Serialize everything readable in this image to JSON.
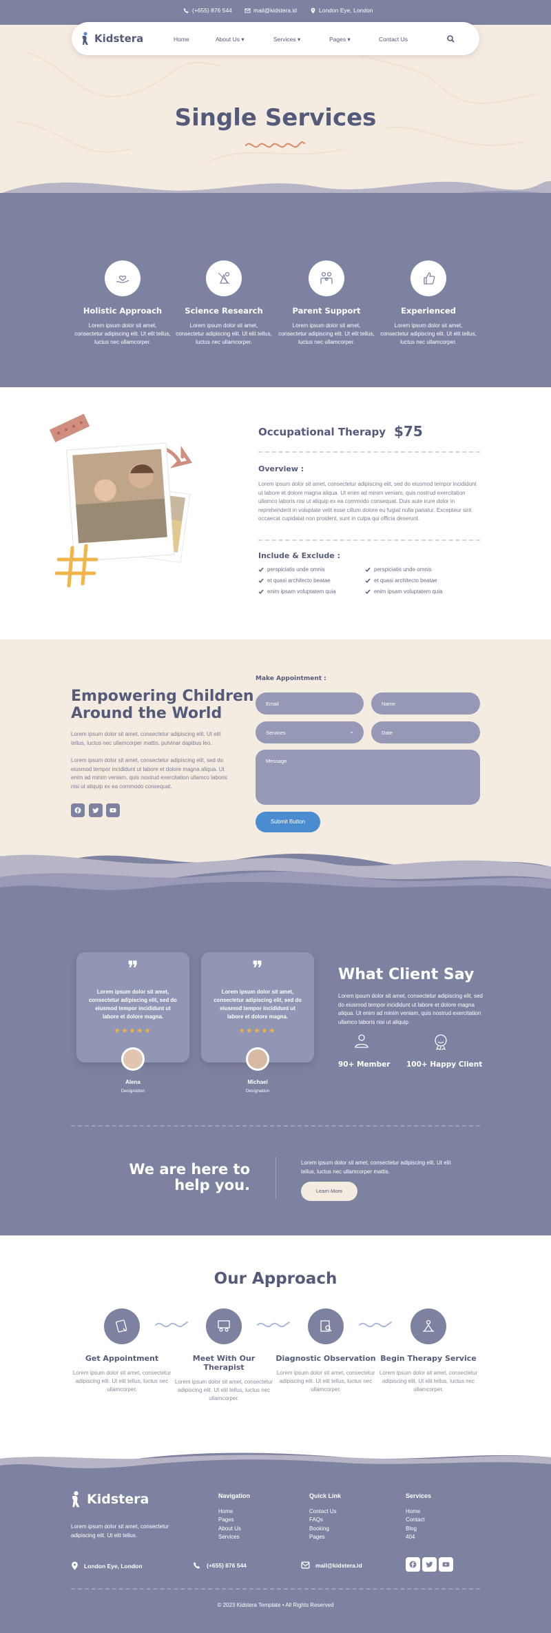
{
  "colors": {
    "slate": "#7d82a0",
    "cream": "#f4ebe1",
    "accent_blue": "#4a8ccf",
    "star": "#f7b733"
  },
  "topbar": {
    "phone": "(+655) 876 544",
    "email": "mail@kidstera.id",
    "location": "London Eye, London"
  },
  "brand": {
    "name": "Kidstera"
  },
  "nav": {
    "home": "Home",
    "about": "About Us",
    "services": "Services",
    "pages": "Pages",
    "contact": "Contact Us"
  },
  "hero": {
    "title": "Single Services"
  },
  "features": [
    {
      "icon": "heart-hand-icon",
      "title": "Holistic Approach",
      "desc": "Lorem ipsum dolor sit amet, consectetur adipiscing elit. Ut elit tellus, luctus nec ullamcorper."
    },
    {
      "icon": "research-icon",
      "title": "Science Research",
      "desc": "Lorem ipsum dolor sit amet, consectetur adipiscing elit. Ut elit tellus, luctus nec ullamcorper."
    },
    {
      "icon": "family-icon",
      "title": "Parent Support",
      "desc": "Lorem ipsum dolor sit amet, consectetur adipiscing elit. Ut elit tellus, luctus nec ullamcorper."
    },
    {
      "icon": "thumbs-up-icon",
      "title": "Experienced",
      "desc": "Lorem ipsum dolor sit amet, consectetur adipiscing elit. Ut elit tellus, luctus nec ullamcorper."
    }
  ],
  "service": {
    "name": "Occupational Therapy",
    "price": "$75",
    "overview_label": "Overview :",
    "overview_text": "Lorem ipsum dolor sit amet, consectetur adipiscing elit, sed do eiusmod tempor incididunt ut labore et dolore magna aliqua. Ut enim ad minim veniam, quis nostrud exercitation ullamco laboris nisi ut aliquip ex ea commodo consequat. Duis aute irure dolor in reprehenderit in voluptate velit esse cillum dolore eu fugiat nulla pariatur. Excepteur sint occaecat cupidatat non proident, sunt in culpa qui officia deserunt.",
    "include_label": "Include & Exclude :",
    "include_left": [
      "perspiciatis unde omnis",
      "et quasi architecto beatae",
      "enim ipsam voluptatem quia"
    ],
    "include_right": [
      "perspiciatis unde omnis",
      "et quasi architecto beatae",
      "enim ipsam voluptatem quia"
    ]
  },
  "appointment": {
    "heading_line1": "Empowering Children",
    "heading_line2": "Around the World",
    "text1": "Lorem ipsum dolor sit amet, consectetur adipiscing elit. Ut elit tellus, luctus nec ullamcorper mattis, pulvinar dapibus leo.",
    "text2": "Lorem ipsum dolor sit amet, consectetur adipiscing elit, sed do eiusmod tempor incididunt ut labore et dolore magna aliqua. Ut enim ad minim veniam, quis nostrud exercitation ullamco laboris nisi ut aliquip ex ea commodo consequat.",
    "form_title": "Make Appointment :",
    "email_ph": "Email",
    "name_ph": "Name",
    "services_ph": "Services",
    "date_ph": "Date",
    "message_ph": "Message",
    "submit": "Submit Button"
  },
  "testimonials": {
    "cards": [
      {
        "quote": "Lorem ipsum dolor sit amet, consectetur adipiscing elit, sed do eiusmod tempor incididunt ut labore et dolore magna.",
        "name": "Alena",
        "role": "Designation"
      },
      {
        "quote": "Lorem ipsum dolor sit amet, consectetur adipiscing elit, sed do eiusmod tempor incididunt ut labore et dolore magna.",
        "name": "Michael",
        "role": "Designation"
      }
    ],
    "heading": "What Client Say",
    "text": "Lorem ipsum dolor sit amet, consectetur adipiscing elit, sed do eiusmod tempor incididunt ut labore et dolore magna aliqua. Ut enim ad minim veniam, quis nostrud exercitation ullamco laboris nisi ut aliquip.",
    "stat1": "90+ Member",
    "stat2": "100+ Happy Client",
    "stars": "★★★★★"
  },
  "cta": {
    "line1": "We are here to",
    "line2": "help you.",
    "text": "Lorem ipsum dolor sit amet, consectetur adipiscing elit. Ut elit tellus, luctus nec ullamcorper mattis.",
    "button": "Learn More"
  },
  "approach": {
    "title": "Our Approach",
    "steps": [
      {
        "title": "Get Appointment",
        "desc": "Lorem ipsum dolor sit amet, consectetur adipiscing elit. Ut elit tellus, luctus nec ullamcorper."
      },
      {
        "title": "Meet With Our Therapist",
        "desc": "Lorem ipsum dolor sit amet, consectetur adipiscing elit. Ut elit tellus, luctus nec ullamcorper."
      },
      {
        "title": "Diagnostic Observation",
        "desc": "Lorem ipsum dolor sit amet, consectetur adipiscing elit. Ut elit tellus, luctus nec ullamcorper."
      },
      {
        "title": "Begin Therapy Service",
        "desc": "Lorem ipsum dolor sit amet, consectetur adipiscing elit. Ut elit tellus, luctus nec ullamcorper."
      }
    ]
  },
  "footer": {
    "about": "Lorem ipsum dolor sit amet, consectetur adipiscing elit. Ut elit tellus.",
    "nav_title": "Navigation",
    "nav_items": [
      "Home",
      "Pages",
      "About Us",
      "Services"
    ],
    "quick_title": "Quick Link",
    "quick_items": [
      "Contact Us",
      "FAQs",
      "Booking",
      "Pages"
    ],
    "services_title": "Services",
    "services_items": [
      "Home",
      "Contact",
      "Blog",
      "404"
    ],
    "location": "London Eye, London",
    "phone": "(+655) 876 544",
    "email": "mail@kidstera.id",
    "copyright": "© 2023 Kidstera Template • All Rights Reserved"
  }
}
